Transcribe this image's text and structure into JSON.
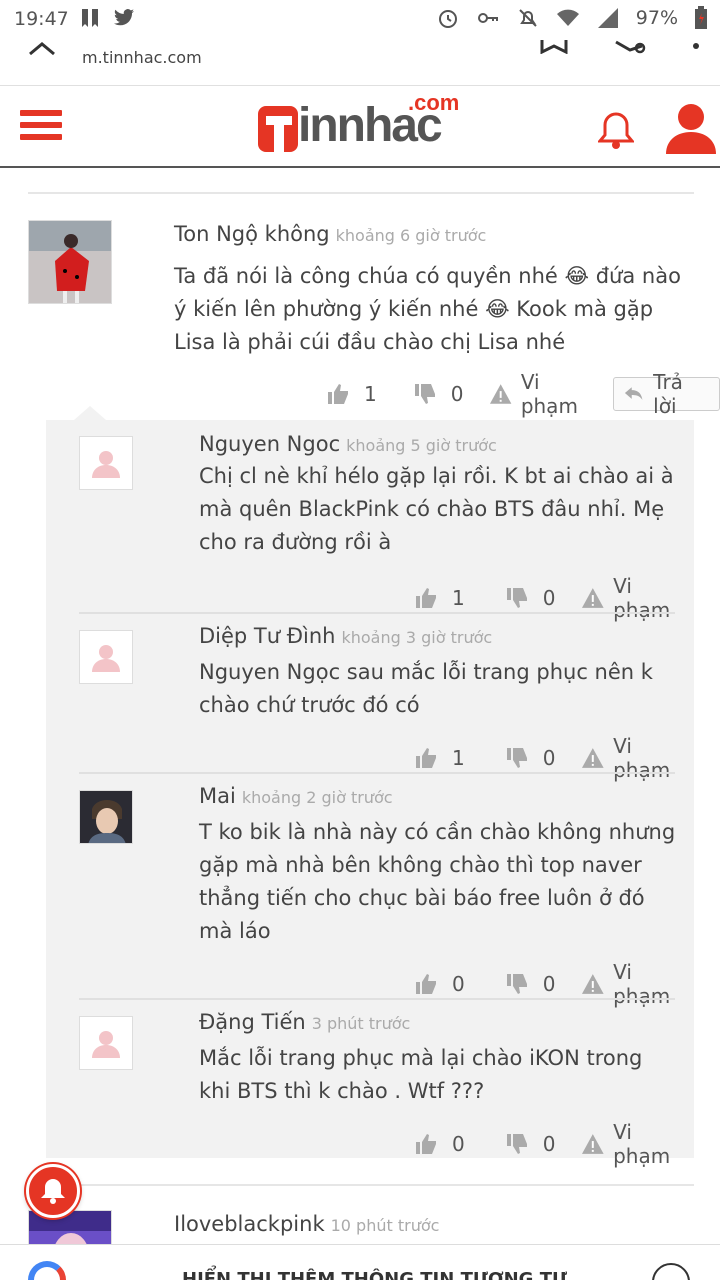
{
  "status_bar": {
    "time": "19:47",
    "battery": "97%"
  },
  "browser": {
    "url": "m.tinnhac.com"
  },
  "site": {
    "logo_text": "innhac",
    "logo_suffix": ".com",
    "brand_color": "#e53524"
  },
  "comments": [
    {
      "name": "Ton Ngộ không",
      "time": "khoảng 6 giờ trước",
      "text": "Ta đã nói là công chúa có quyền nhé 😂 đứa nào ý kiến lên phường ý kiến nhé 😂 Kook mà gặp Lisa là phải cúi đầu chào chị Lisa nhé",
      "likes": "1",
      "dislikes": "0",
      "report": "Vi phạm",
      "reply": "Trả lời"
    }
  ],
  "replies": [
    {
      "name": "Nguyen Ngoc",
      "time": "khoảng 5 giờ trước",
      "text": "Chị cl nè khỉ hélo gặp lại rồi. K bt ai chào ai à mà quên BlackPink có chào BTS đâu nhỉ. Mẹ cho ra đường rồi à",
      "likes": "1",
      "dislikes": "0",
      "report": "Vi phạm"
    },
    {
      "name": "Diệp Tư Đình",
      "time": "khoảng 3 giờ trước",
      "text": "Nguyen Ngọc sau mắc lỗi trang phục nên k chào chứ trước đó có",
      "likes": "1",
      "dislikes": "0",
      "report": "Vi phạm"
    },
    {
      "name": "Mai",
      "time": "khoảng 2 giờ trước",
      "text": "T ko bik là nhà này có cần chào không nhưng gặp mà nhà bên không chào thì top naver thẳng tiến cho chục bài báo free luôn ở đó mà láo",
      "likes": "0",
      "dislikes": "0",
      "report": "Vi phạm"
    },
    {
      "name": "Đặng Tiến",
      "time": "3 phút trước",
      "text": "Mắc lỗi trang phục mà lại chào iKON trong khi BTS thì k chào . Wtf ???",
      "likes": "0",
      "dislikes": "0",
      "report": "Vi phạm"
    }
  ],
  "next_comment": {
    "name": "Iloveblackpink",
    "time": "10 phút trước"
  },
  "bottom_banner": {
    "text": "HIỂN THỊ THÊM THÔNG TIN TƯƠNG TỰ"
  }
}
